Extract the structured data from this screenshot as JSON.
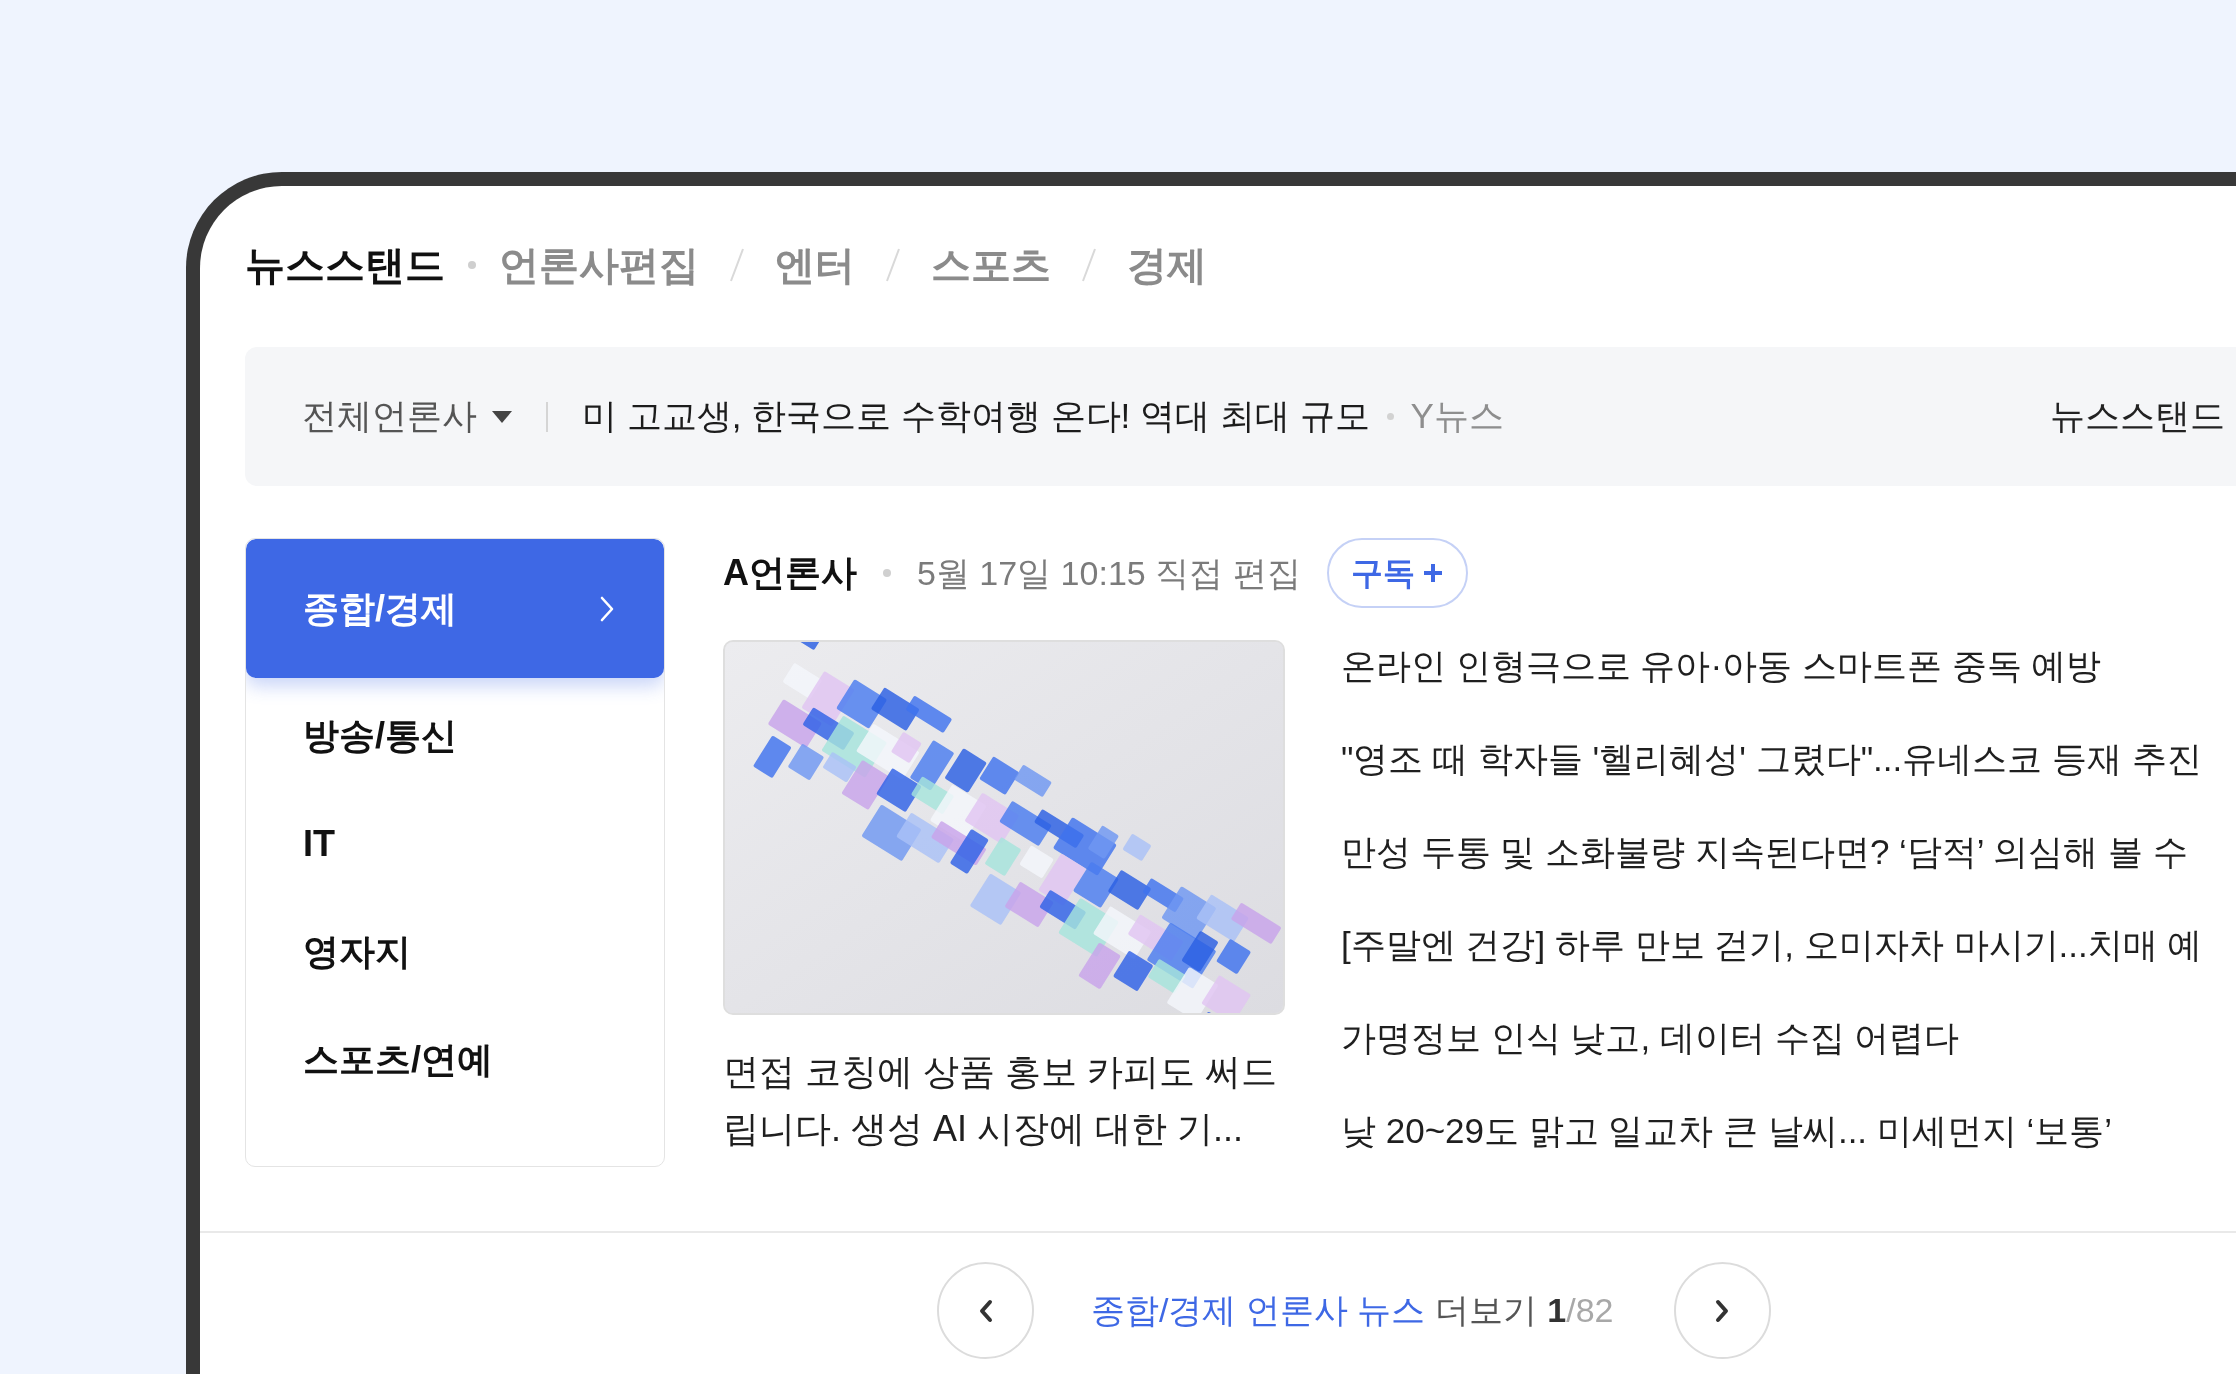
{
  "header": {
    "title": "뉴스스탠드",
    "tabs": [
      {
        "label": "언론사편집",
        "selected": false
      },
      {
        "label": "엔터",
        "selected": false
      },
      {
        "label": "스포츠",
        "selected": false
      },
      {
        "label": "경제",
        "selected": false
      }
    ]
  },
  "ticker": {
    "filter": "전체언론사",
    "headline": "미 고교생, 한국으로 수학여행 온다! 역대 최대 규모",
    "source": "Y뉴스",
    "end_link": "뉴스스탠드"
  },
  "categories": [
    {
      "label": "종합/경제",
      "selected": true
    },
    {
      "label": "방송/통신",
      "selected": false
    },
    {
      "label": "IT",
      "selected": false
    },
    {
      "label": "영자지",
      "selected": false
    },
    {
      "label": "스포츠/연예",
      "selected": false
    }
  ],
  "publisher": {
    "name": "A언론사",
    "edited": "5월 17일 10:15 직접 편집",
    "subscribe_label": "구독"
  },
  "featured": {
    "caption": "면접 코칭에 상품 홍보 카피도 써드립니다. 생성 AI 시장에 대한 기..."
  },
  "headlines": [
    "온라인 인형극으로 유아·아동 스마트폰 중독 예방",
    "\"영조 때 학자들 '헬리혜성' 그렸다\"...유네스코 등재 추진",
    "만성 두통 및 소화불량 지속된다면? ‘담적’ 의심해 볼 수",
    "[주말엔 건강] 하루 만보 걷기, 오미자차 마시기...치매 예",
    "가명정보 인식 낮고, 데이터 수집 어렵다",
    "낮 20~29도 맑고 일교차 큰 날씨... 미세먼지 ‘보통’"
  ],
  "pager": {
    "category_link": "종합/경제 언론사 뉴스",
    "more_label": "더보기",
    "current_page": "1",
    "total_pages": "/82"
  }
}
